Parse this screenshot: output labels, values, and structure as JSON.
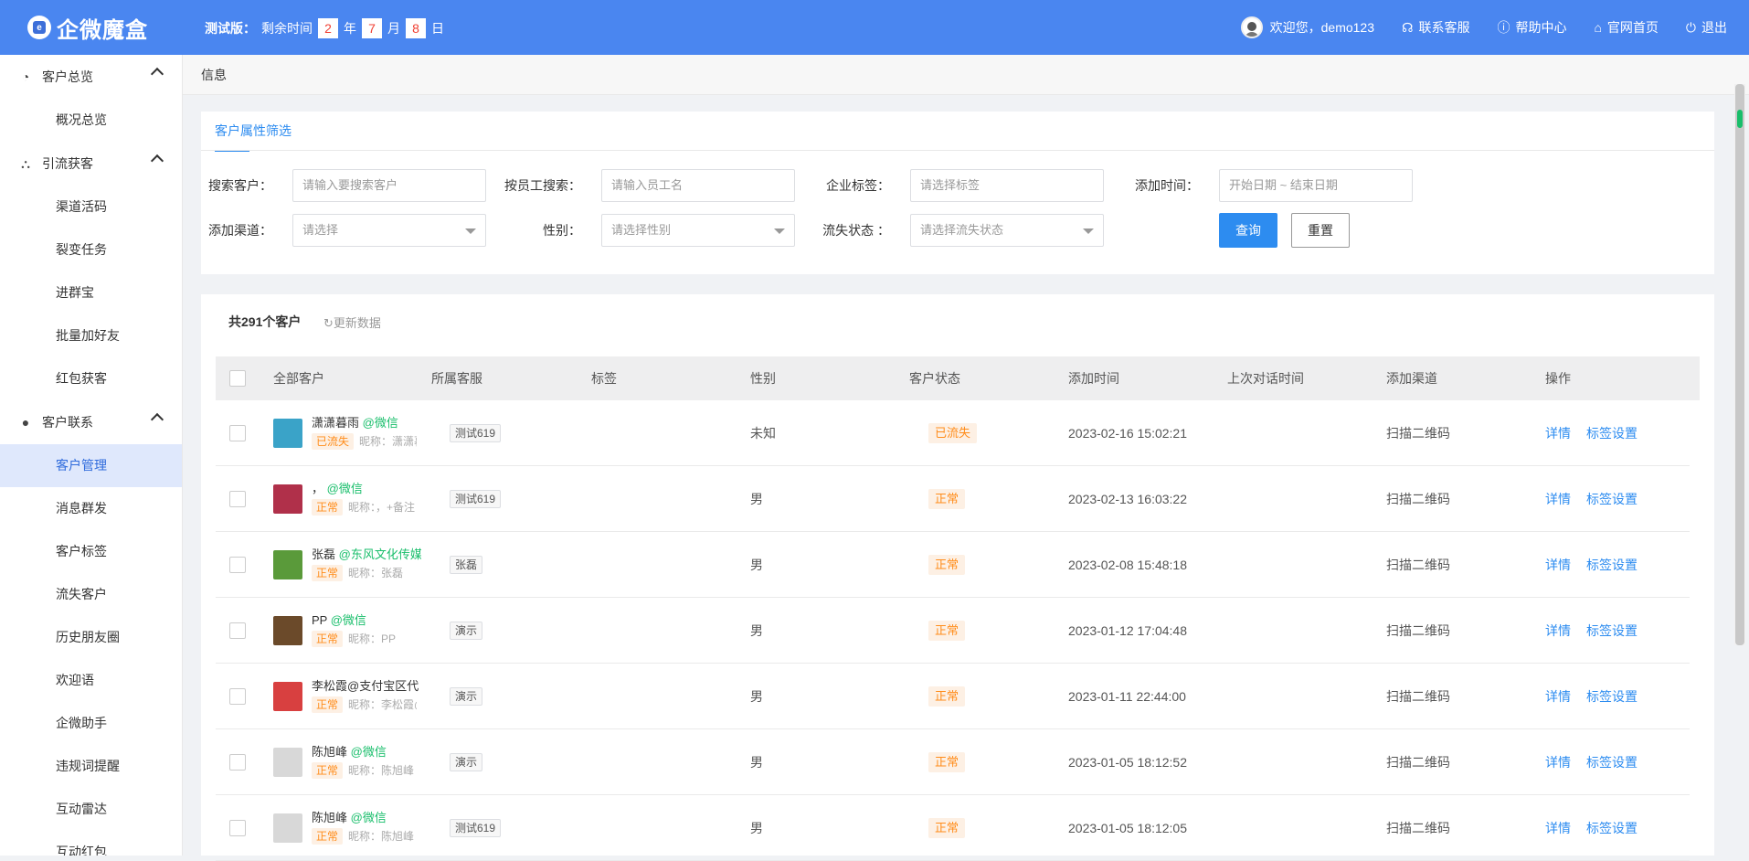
{
  "header": {
    "logo_text": "企微魔盒",
    "trial_label": "测试版：",
    "remaining_label": "剩余时间",
    "years": "2",
    "year_unit": "年",
    "months": "7",
    "month_unit": "月",
    "days": "8",
    "day_unit": "日",
    "welcome": "欢迎您，demo123",
    "contact": "联系客服",
    "help": "帮助中心",
    "home": "官网首页",
    "logout": "退出"
  },
  "sidebar": {
    "groups": [
      {
        "label": "客户总览",
        "items": [
          "概况总览"
        ]
      },
      {
        "label": "引流获客",
        "items": [
          "渠道活码",
          "裂变任务",
          "进群宝",
          "批量加好友",
          "红包获客"
        ]
      },
      {
        "label": "客户联系",
        "items": [
          "客户管理",
          "消息群发",
          "客户标签",
          "流失客户",
          "历史朋友圈",
          "欢迎语",
          "企微助手",
          "违规词提醒",
          "互动雷达",
          "互动红包"
        ]
      }
    ]
  },
  "breadcrumb": "信息",
  "filter": {
    "tab": "客户属性筛选",
    "search_customer_label": "搜索客户：",
    "search_customer_placeholder": "请输入要搜索客户",
    "employee_label": "按员工搜索：",
    "employee_placeholder": "请输入员工名",
    "corp_tag_label": "企业标签：",
    "corp_tag_placeholder": "请选择标签",
    "add_time_label": "添加时间：",
    "add_time_placeholder": "开始日期 ~ 结束日期",
    "channel_label": "添加渠道：",
    "channel_placeholder": "请选择",
    "gender_label": "性别：",
    "gender_placeholder": "请选择性别",
    "lost_label": "流失状态 ：",
    "lost_placeholder": "请选择流失状态",
    "query_button": "查询",
    "reset_button": "重置"
  },
  "list": {
    "total": "共291个客户",
    "refresh": "更新数据",
    "columns": [
      "全部客户",
      "所属客服",
      "标签",
      "性别",
      "客户状态",
      "添加时间",
      "上次对话时间",
      "添加渠道",
      "操作"
    ],
    "detail_link": "详情",
    "tag_link": "标签设置",
    "rows": [
      {
        "name": "潇潇暮雨",
        "source": "@微信",
        "badge": "已流失",
        "nick": "昵称：潇潇暮雨",
        "service": "测试619",
        "gender": "未知",
        "status": "已流失",
        "add_time": "2023-02-16 15:02:21",
        "channel": "扫描二维码",
        "avatar_color": "#3aa3c8"
      },
      {
        "name": "，",
        "source": "@微信",
        "badge": "正常",
        "nick": "昵称：，+备注",
        "service": "测试619",
        "gender": "男",
        "status": "正常",
        "add_time": "2023-02-13 16:03:22",
        "channel": "扫描二维码",
        "avatar_color": "#b0304a"
      },
      {
        "name": "张磊",
        "source": "@东风文化传媒",
        "badge": "正常",
        "nick": "昵称：张磊",
        "service": "张磊",
        "gender": "男",
        "status": "正常",
        "add_time": "2023-02-08 15:48:18",
        "channel": "扫描二维码",
        "avatar_color": "#5a9a3a"
      },
      {
        "name": "PP",
        "source": "@微信",
        "badge": "正常",
        "nick": "昵称：PP",
        "service": "演示",
        "gender": "男",
        "status": "正常",
        "add_time": "2023-01-12 17:04:48",
        "channel": "扫描二维码",
        "avatar_color": "#6b4a2a"
      },
      {
        "name": "李松霞@支付宝区代",
        "source": "",
        "badge": "正常",
        "nick": "昵称：李松霞@",
        "service": "演示",
        "gender": "男",
        "status": "正常",
        "add_time": "2023-01-11 22:44:00",
        "channel": "扫描二维码",
        "avatar_color": "#d84040"
      },
      {
        "name": "陈旭峰",
        "source": "@微信",
        "badge": "正常",
        "nick": "昵称：陈旭峰",
        "service": "演示",
        "gender": "男",
        "status": "正常",
        "add_time": "2023-01-05 18:12:52",
        "channel": "扫描二维码",
        "avatar_color": "#d8d8d8"
      },
      {
        "name": "陈旭峰",
        "source": "@微信",
        "badge": "正常",
        "nick": "昵称：陈旭峰",
        "service": "测试619",
        "gender": "男",
        "status": "正常",
        "add_time": "2023-01-05 18:12:05",
        "channel": "扫描二维码",
        "avatar_color": "#d8d8d8"
      }
    ]
  }
}
